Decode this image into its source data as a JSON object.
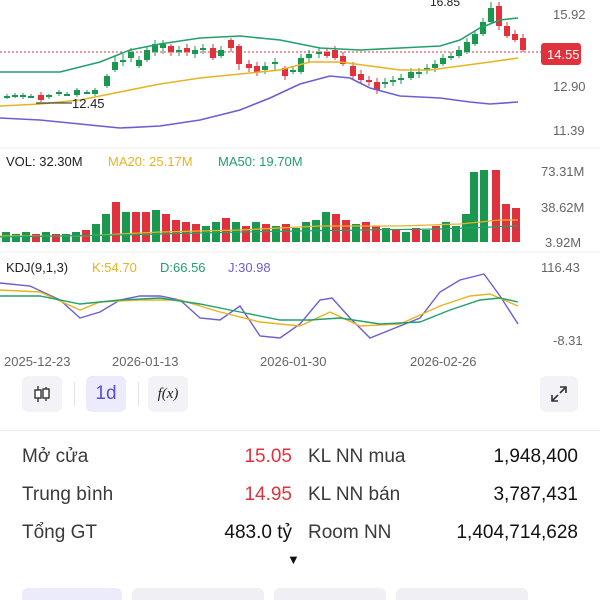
{
  "price_axis": {
    "top": "15.92",
    "current": "14.55",
    "mid": "12.90",
    "bottom": "11.39",
    "high_marker": "16.85",
    "low_marker": "12.45"
  },
  "volume_panel": {
    "vol_label": "VOL: 32.30M",
    "ma20_label": "MA20: 25.17M",
    "ma50_label": "MA50: 19.70M",
    "axis_top": "73.31M",
    "axis_mid": "38.62M",
    "axis_bottom": "3.92M"
  },
  "kdj_panel": {
    "title": "KDJ(9,1,3)",
    "k_label": "K:54.70",
    "d_label": "D:66.56",
    "j_label": "J:30.98",
    "axis_top": "116.43",
    "axis_bottom": "-8.31"
  },
  "dates": [
    "2025-12-23",
    "2026-01-13",
    "2026-01-30",
    "2026-02-26"
  ],
  "toolbar": {
    "interval_label": "1d",
    "formula_label": "f(x)"
  },
  "stats": {
    "open_label": "Mở cửa",
    "open_value": "15.05",
    "avg_label": "Trung bình",
    "avg_value": "14.95",
    "total_label": "Tổng GT",
    "total_value": "483.0 tỷ",
    "foreign_buy_label": "KL NN mua",
    "foreign_buy_value": "1,948,400",
    "foreign_sell_label": "KL NN bán",
    "foreign_sell_value": "3,787,431",
    "room_label": "Room NN",
    "room_value": "1,404,714,628"
  },
  "colors": {
    "up": "#1a9850",
    "down": "#e0323c",
    "ma_yellow": "#e6b422",
    "ma_green": "#22a06b",
    "band_purple": "#6a5fd0",
    "accent": "#5a4fcf"
  },
  "icons": {
    "chart_type": "candlestick-icon",
    "formula": "function-icon",
    "expand": "expand-icon",
    "more": "caret-down-icon"
  }
}
